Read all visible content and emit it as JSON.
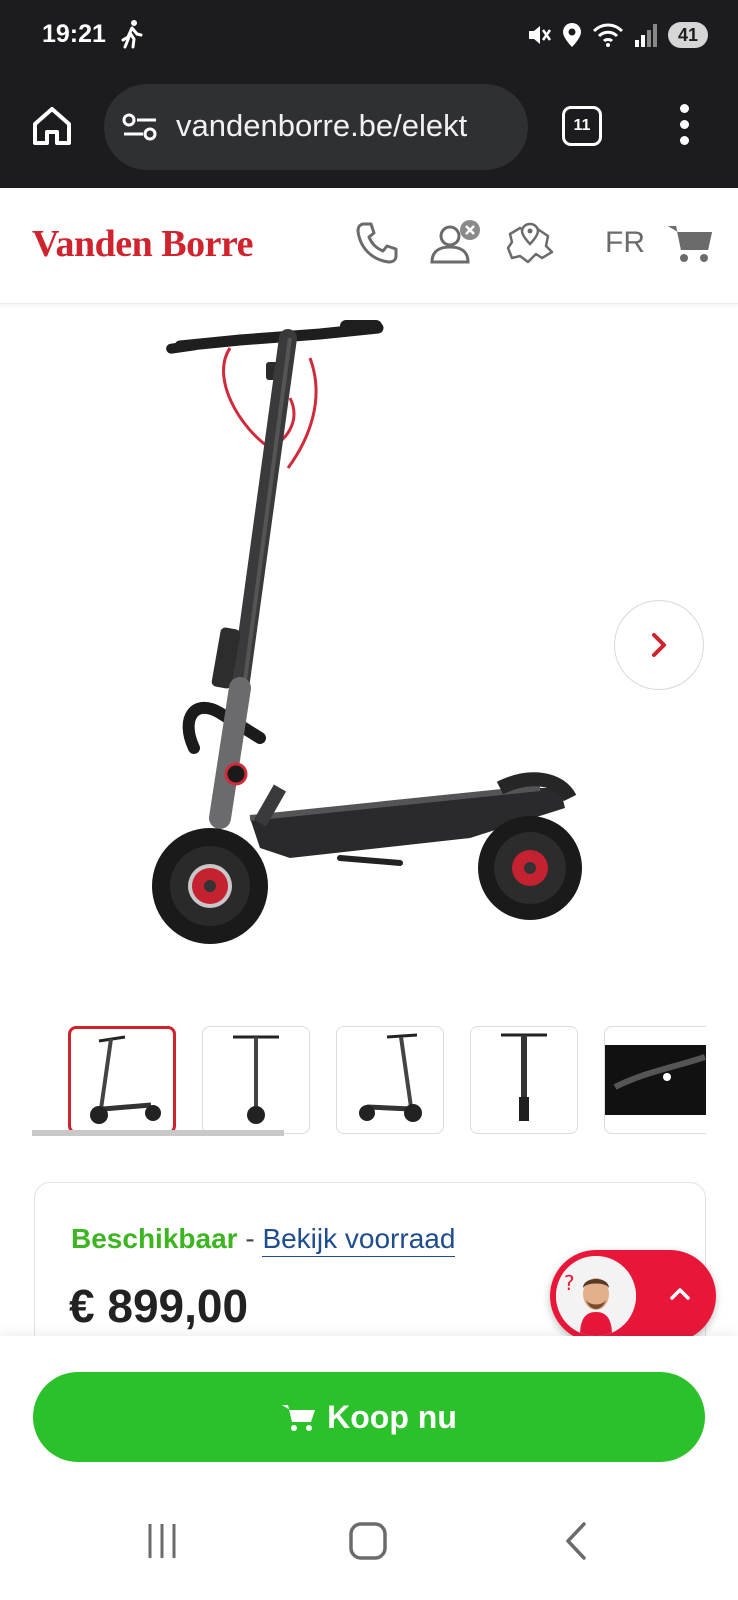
{
  "status_bar": {
    "time": "19:21",
    "battery": "41"
  },
  "browser": {
    "url": "vandenborre.be/elekt",
    "tab_count": "11"
  },
  "site_header": {
    "logo": "Vanden Borre",
    "language": "FR",
    "brand_color": "#d0232e"
  },
  "product": {
    "image_alt": "Segway elektrische step",
    "thumbnail_count": 5,
    "active_thumbnail": 1
  },
  "stock": {
    "status": "Beschikbaar",
    "separator": " - ",
    "link": "Bekijk voorraad"
  },
  "price": "€ 899,00",
  "buy_button": {
    "label": "Koop nu",
    "color": "#2bc12b"
  }
}
